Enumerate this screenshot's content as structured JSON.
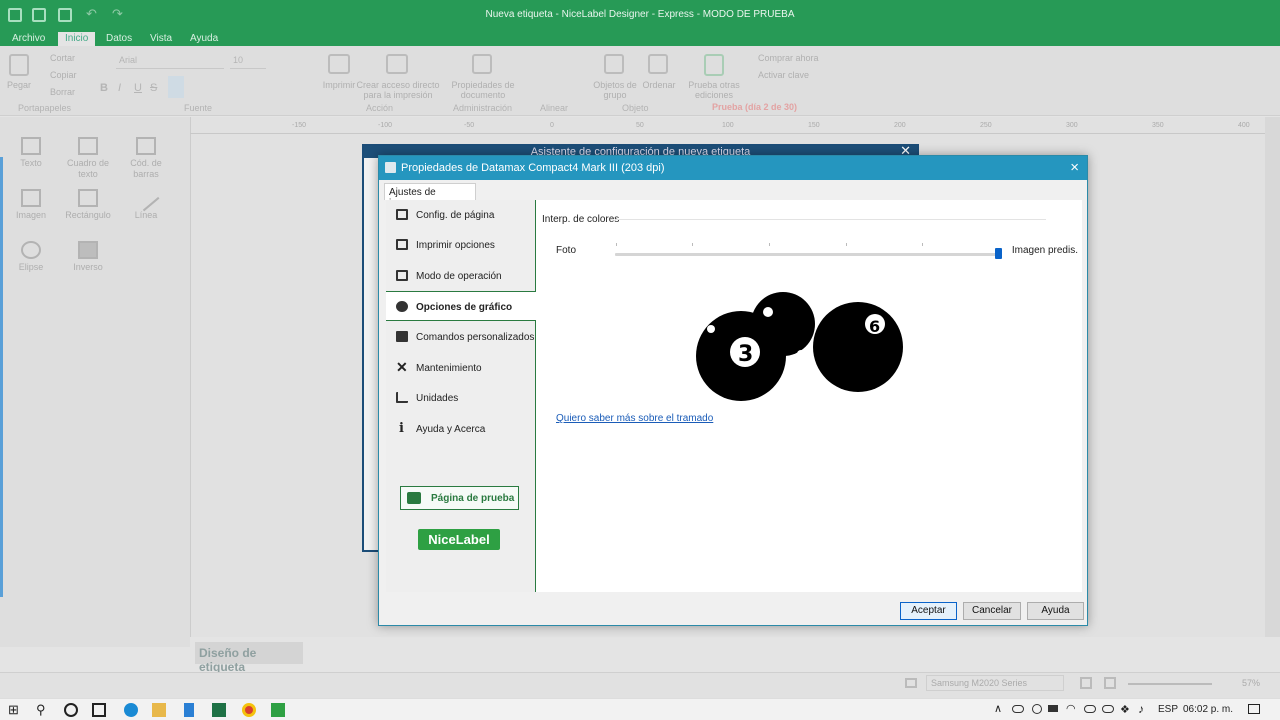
{
  "app": {
    "window_title": "Nueva etiqueta - NiceLabel Designer - Express - MODO DE PRUEBA",
    "menu_tabs": [
      "Archivo",
      "Inicio",
      "Datos",
      "Vista",
      "Ayuda"
    ],
    "ribbon": {
      "paste": "Pegar",
      "cut": "Cortar",
      "copy": "Copiar",
      "delete": "Borrar",
      "font_name": "Arial",
      "font_size": "10",
      "print": "Imprimir",
      "shortcut": "Crear acceso directo\npara la impresión",
      "doc_props": "Propiedades de\ndocumento",
      "group_objects": "Objetos de\ngrupo",
      "order": "Ordenar",
      "try_editions": "Prueba otras\nediciones",
      "buy": "Comprar ahora",
      "activate": "Activar clave",
      "trial": "Prueba (día 2 de 30)",
      "groups": [
        "Portapapeles",
        "Fuente",
        "Acción",
        "Administración",
        "Alinear",
        "Objeto"
      ]
    },
    "tools": [
      "Texto",
      "Cuadro de\ntexto",
      "Cód. de\nbarras",
      "Imagen",
      "Rectángulo",
      "Línea",
      "Elipse",
      "Inverso"
    ],
    "ruler_labels": [
      "-150",
      "-100",
      "-50",
      "0",
      "50",
      "100",
      "150",
      "200",
      "250",
      "300",
      "350",
      "400"
    ],
    "design_tab": "Diseño de etiqueta",
    "status_printer": "Samsung M2020 Series",
    "zoom": "57%"
  },
  "wizard": {
    "title": "Asistente de configuración de nueva etiqueta"
  },
  "dialog": {
    "title": "Propiedades de Datamax Compact4 Mark III (203 dpi)",
    "tab": "Ajustes de impresora",
    "nav": [
      {
        "label": "Config. de página",
        "icon": "page-icon"
      },
      {
        "label": "Imprimir opciones",
        "icon": "printer-icon"
      },
      {
        "label": "Modo de operación",
        "icon": "printer-mode-icon"
      },
      {
        "label": "Opciones de gráfico",
        "icon": "graphic-icon"
      },
      {
        "label": "Comandos personalizados",
        "icon": "command-icon"
      },
      {
        "label": "Mantenimiento",
        "icon": "tools-icon"
      },
      {
        "label": "Unidades",
        "icon": "units-icon"
      },
      {
        "label": "Ayuda y Acerca",
        "icon": "info-icon"
      }
    ],
    "selected_nav": 3,
    "test_page": "Página de prueba",
    "logo": "NiceLabel",
    "group_label": "Interp. de colores",
    "slider_left": "Foto",
    "slider_right": "Imagen predis.",
    "slider_value": 1.0,
    "link": "Quiero saber más sobre el tramado",
    "buttons": {
      "ok": "Aceptar",
      "cancel": "Cancelar",
      "help": "Ayuda"
    }
  },
  "taskbar": {
    "lang": "ESP",
    "time": "06:02 p. m."
  },
  "colors": {
    "app_green": "#279a56",
    "dialog_title": "#2596bf",
    "nav_accent": "#2a7a40",
    "link": "#1a5cb8",
    "slider_thumb": "#0a63c9"
  }
}
